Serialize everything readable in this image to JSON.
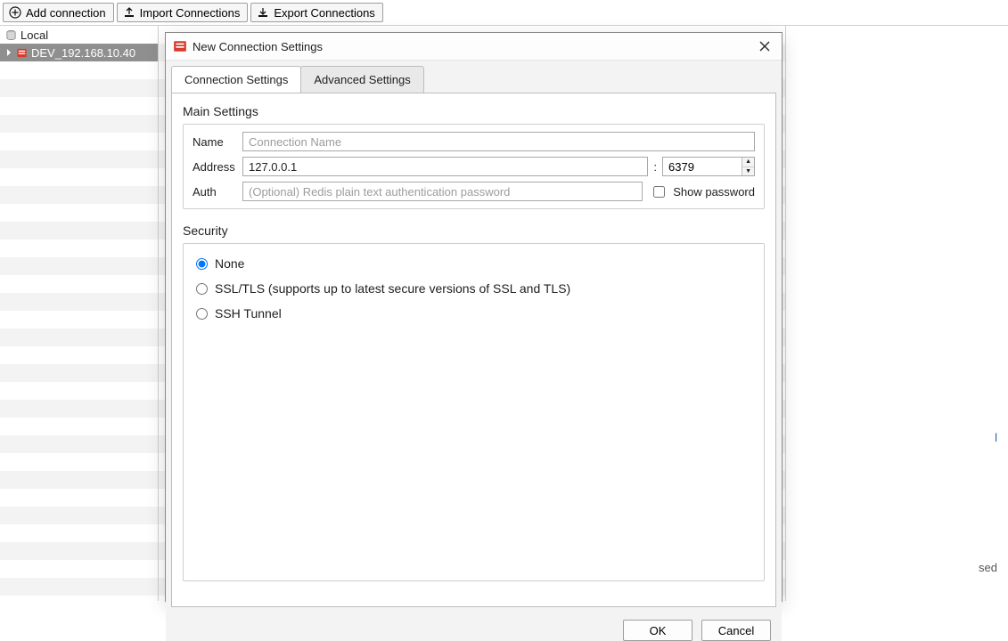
{
  "toolbar": {
    "add_label": "Add connection",
    "import_label": "Import Connections",
    "export_label": "Export Connections"
  },
  "sidebar": {
    "items": [
      {
        "label": "Local",
        "kind": "local"
      },
      {
        "label": "DEV_192.168.10.40",
        "kind": "remote",
        "selected": true
      }
    ]
  },
  "content": {
    "side_link_suffix": "l",
    "side_status_suffix": "sed"
  },
  "dialog": {
    "title": "New Connection Settings",
    "tabs": [
      {
        "label": "Connection Settings",
        "active": true
      },
      {
        "label": "Advanced Settings"
      }
    ],
    "main_settings": {
      "section_title": "Main Settings",
      "name_label": "Name",
      "name_placeholder": "Connection Name",
      "name_value": "",
      "address_label": "Address",
      "address_value": "127.0.0.1",
      "port_value": "6379",
      "auth_label": "Auth",
      "auth_placeholder": "(Optional) Redis plain text authentication password",
      "auth_value": "",
      "show_password_label": "Show password",
      "show_password_checked": false
    },
    "security": {
      "section_title": "Security",
      "options": [
        {
          "label": "None",
          "checked": true
        },
        {
          "label": "SSL/TLS (supports up to latest secure versions of SSL and TLS)"
        },
        {
          "label": "SSH Tunnel"
        }
      ]
    },
    "ok_label": "OK",
    "cancel_label": "Cancel"
  }
}
